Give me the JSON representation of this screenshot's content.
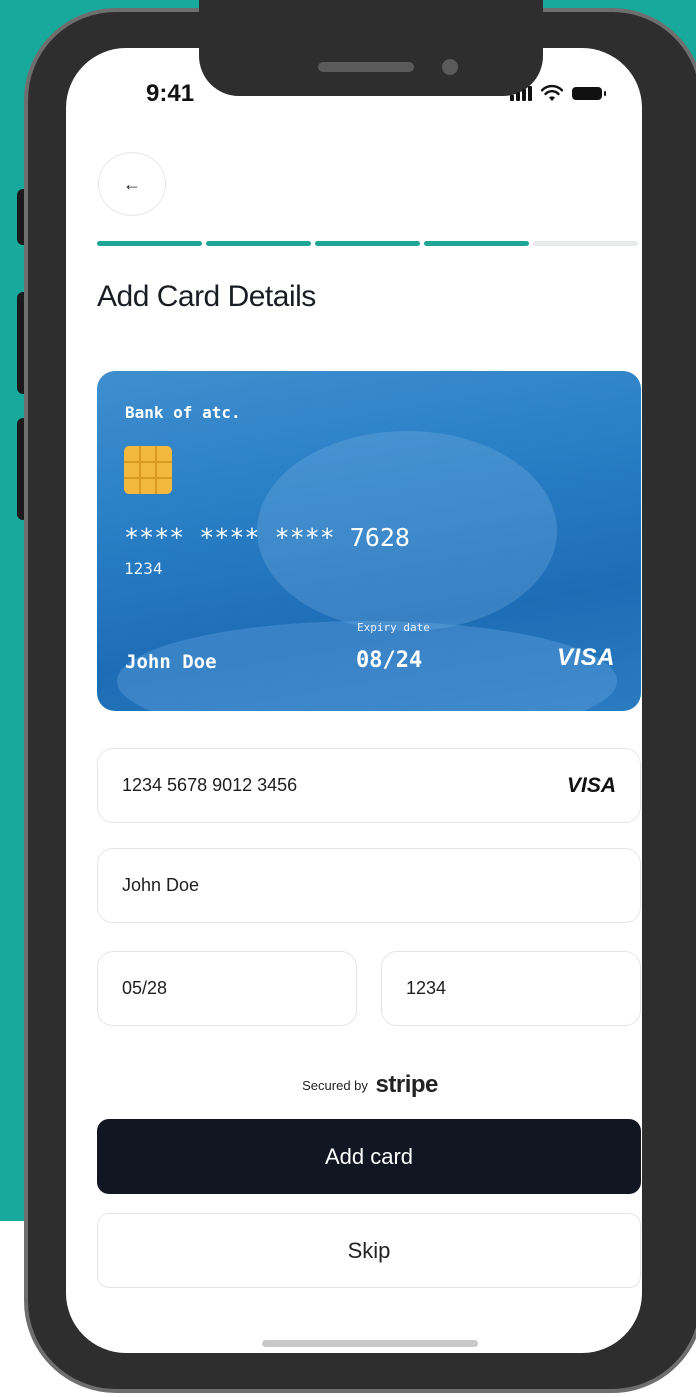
{
  "status_bar": {
    "time": "9:41"
  },
  "header": {
    "back_icon": "arrow-left-icon",
    "back_glyph": "←",
    "title": "Add Card Details",
    "progress": {
      "total_steps": 5,
      "completed_steps": 4,
      "active_color": "#1fa595",
      "inactive_color": "#e8eaec"
    }
  },
  "card_preview": {
    "bank": "Bank of atc.",
    "number_masked": "**** **** **** 7628",
    "cvv": "1234",
    "expiry_label": "Expiry date",
    "expiry": "08/24",
    "holder": "John Doe",
    "brand": "VISA",
    "color": "#2a7fc5"
  },
  "form": {
    "card_number": "1234 5678 9012 3456",
    "card_brand": "VISA",
    "name": "John Doe",
    "expiry": "05/28",
    "cvv": "1234"
  },
  "security": {
    "prefix": "Secured by",
    "provider": "stripe"
  },
  "actions": {
    "add_label": "Add card",
    "skip_label": "Skip"
  },
  "colors": {
    "background": "#17a99b",
    "primary_button": "#121623"
  }
}
